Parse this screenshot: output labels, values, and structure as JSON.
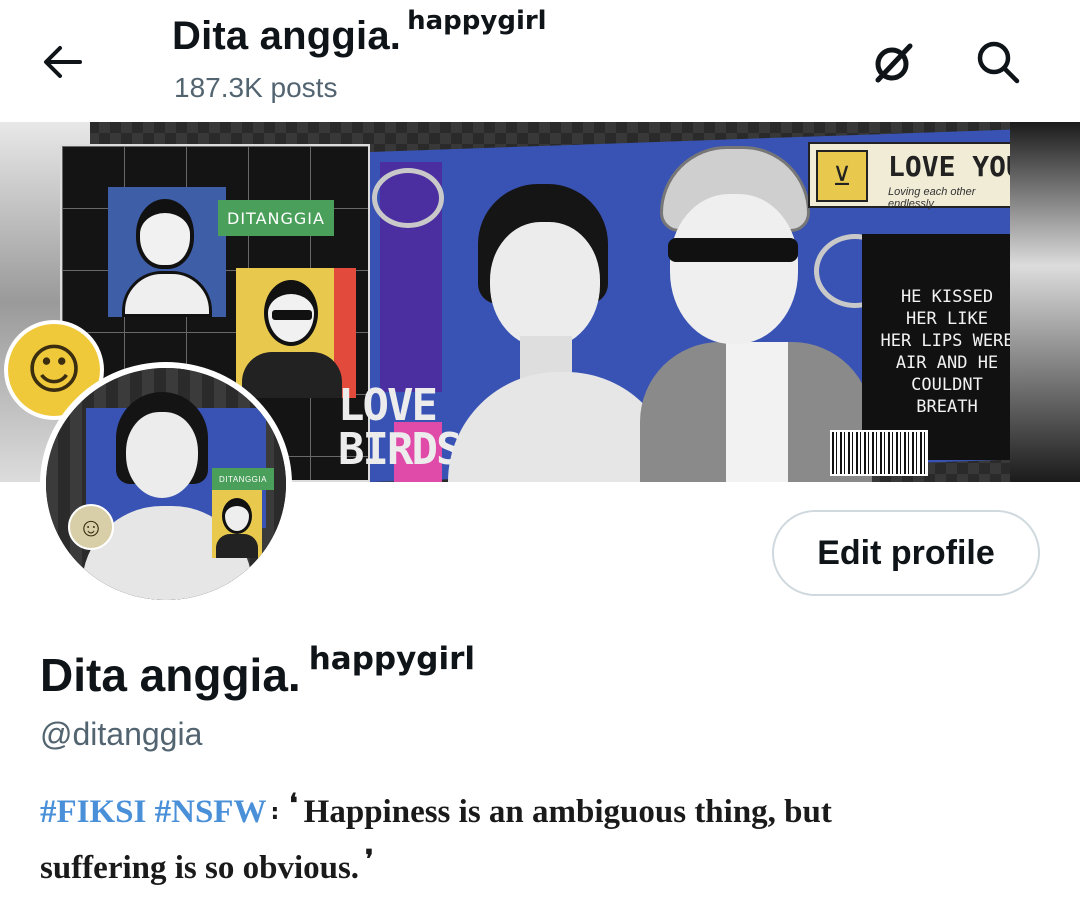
{
  "header": {
    "title": "Dita anggia.",
    "title_suffix": "happygirl",
    "posts_count": "187.3K posts",
    "icons": [
      "back-arrow-icon",
      "grok-icon",
      "search-icon"
    ]
  },
  "banner": {
    "tag_text": "DITANGGIA",
    "love_birds_line1": "LOVE",
    "love_birds_line2": "BIRDS",
    "love_you_title": "LOVE YOU",
    "love_you_subtitle": "Loving each other endlessly",
    "quote_lines": [
      "HE KISSED",
      "HER LIKE",
      "HER LIPS WERE",
      "AIR AND HE",
      "COULDNT",
      "BREATH"
    ]
  },
  "avatar": {
    "tag_text": "DITANGGIA"
  },
  "actions": {
    "edit_profile_label": "Edit profile"
  },
  "profile": {
    "name": "Dita anggia.",
    "name_suffix": "happygirl",
    "handle": "@ditanggia",
    "bio": {
      "hashtags": [
        "#FIKSI",
        "#NSFW"
      ],
      "separator": ":",
      "open_quote": "❛",
      "text_line1": "Happiness is an ambiguous thing, but",
      "text_line2": "suffering is so obvious.",
      "close_quote": "❜"
    }
  },
  "colors": {
    "text_primary": "#0f1419",
    "text_secondary": "#536471",
    "hashtag": "#4a90d9",
    "border": "#cfd9de"
  }
}
